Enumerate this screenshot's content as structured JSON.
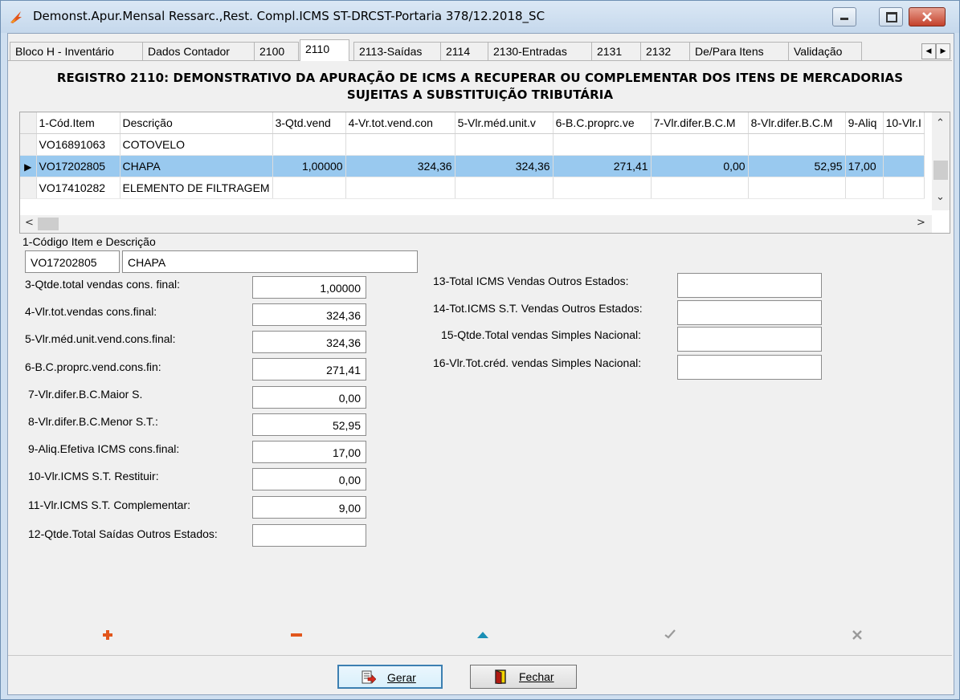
{
  "window": {
    "title": "Demonst.Apur.Mensal Ressarc.,Rest. Compl.ICMS ST-DRCST-Portaria 378/12.2018_SC"
  },
  "tabs": [
    {
      "label": "Bloco H - Inventário"
    },
    {
      "label": "Dados Contador"
    },
    {
      "label": "2100"
    },
    {
      "label": "2110"
    },
    {
      "label": "2113-Saídas"
    },
    {
      "label": "2114"
    },
    {
      "label": "2130-Entradas"
    },
    {
      "label": "2131"
    },
    {
      "label": "2132"
    },
    {
      "label": "De/Para Itens"
    },
    {
      "label": "Validação"
    }
  ],
  "active_tab": "2110",
  "heading": {
    "line1": "REGISTRO 2110: DEMONSTRATIVO DA APURAÇÃO DE ICMS A RECUPERAR OU COMPLEMENTAR DOS ITENS DE MERCADORIAS",
    "line2": "SUJEITAS A SUBSTITUIÇÃO TRIBUTÁRIA"
  },
  "grid": {
    "columns": [
      "1-Cód.Item",
      "Descrição",
      "3-Qtd.vend",
      "4-Vr.tot.vend.con",
      "5-Vlr.méd.unit.v",
      "6-B.C.proprc.ve",
      "7-Vlr.difer.B.C.M",
      "8-Vlr.difer.B.C.M",
      "9-Aliq",
      "10-Vlr.I"
    ],
    "rows": [
      {
        "cells": [
          "VO16891063",
          "COTOVELO",
          "",
          "",
          "",
          "",
          "",
          "",
          "",
          ""
        ],
        "selected": false
      },
      {
        "cells": [
          "VO17202805",
          "CHAPA",
          "1,00000",
          "324,36",
          "324,36",
          "271,41",
          "0,00",
          "52,95",
          "17,00",
          ""
        ],
        "selected": true
      },
      {
        "cells": [
          "VO17410282",
          "ELEMENTO DE FILTRAGEM",
          "",
          "",
          "",
          "",
          "",
          "",
          "",
          ""
        ],
        "selected": false
      }
    ]
  },
  "form": {
    "item_label": "1-Código Item e Descrição",
    "item_code": "VO17202805",
    "item_desc": "CHAPA",
    "fields_left": [
      {
        "label": "3-Qtde.total vendas cons. final:",
        "value": "1,00000"
      },
      {
        "label": "4-Vlr.tot.vendas cons.final:",
        "value": "324,36"
      },
      {
        "label": "5-Vlr.méd.unit.vend.cons.final:",
        "value": "324,36"
      },
      {
        "label": "6-B.C.proprc.vend.cons.fin:",
        "value": "271,41"
      },
      {
        "label": "7-Vlr.difer.B.C.Maior S.",
        "value": "0,00"
      },
      {
        "label": "8-Vlr.difer.B.C.Menor S.T.:",
        "value": "52,95"
      },
      {
        "label": "9-Aliq.Efetiva ICMS cons.final:",
        "value": "17,00"
      },
      {
        "label": "10-Vlr.ICMS S.T. Restituir:",
        "value": "0,00"
      },
      {
        "label": "11-Vlr.ICMS S.T. Complementar:",
        "value": "9,00"
      },
      {
        "label": "12-Qtde.Total Saídas Outros Estados:",
        "value": ""
      }
    ],
    "fields_right": [
      {
        "label": "13-Total ICMS Vendas Outros Estados:",
        "value": ""
      },
      {
        "label": "14-Tot.ICMS S.T. Vendas Outros Estados:",
        "value": ""
      },
      {
        "label": "15-Qtde.Total vendas Simples Nacional:",
        "value": ""
      },
      {
        "label": "16-Vlr.Tot.créd. vendas Simples Nacional:",
        "value": ""
      }
    ]
  },
  "navigator": {
    "insert_icon": "plus-icon",
    "delete_icon": "minus-icon",
    "edit_icon": "triangle-up-icon",
    "post_icon": "check-icon",
    "cancel_icon": "x-icon"
  },
  "buttons": {
    "gerar": "Gerar",
    "fechar": "Fechar"
  },
  "colors": {
    "selection": "#99c9ef",
    "insert": "#e2561c",
    "delete": "#e2561c",
    "edit": "#1a8fb5",
    "disabled": "#9a9a9a"
  }
}
